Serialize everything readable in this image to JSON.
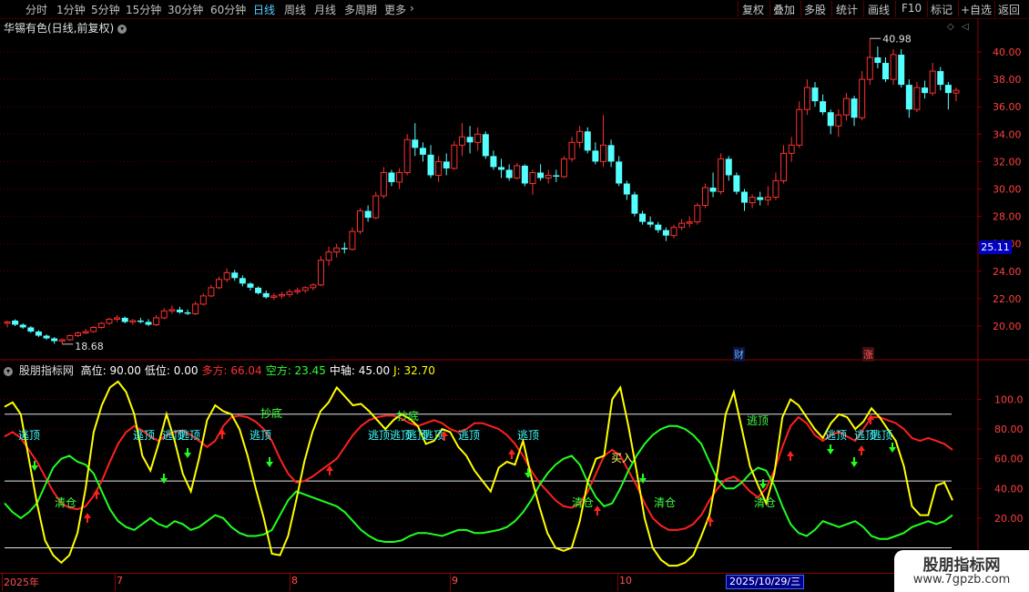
{
  "toolbar": {
    "periods": [
      {
        "label": "分时",
        "active": false
      },
      {
        "label": "1分钟",
        "active": false
      },
      {
        "label": "5分钟",
        "active": false
      },
      {
        "label": "15分钟",
        "active": false
      },
      {
        "label": "30分钟",
        "active": false
      },
      {
        "label": "60分钟",
        "active": false
      },
      {
        "label": "日线",
        "active": true
      },
      {
        "label": "周线",
        "active": false
      },
      {
        "label": "月线",
        "active": false
      },
      {
        "label": "多周期",
        "active": false
      },
      {
        "label": "更多",
        "active": false
      }
    ],
    "more_glyph": "›",
    "actions": [
      "复权",
      "叠加",
      "多股",
      "统计",
      "画线",
      "F10",
      "标记",
      "+自选",
      "返回"
    ]
  },
  "chart_title": "华锡有色(日线,前复权)",
  "price_axis_ticks": [
    "40.00",
    "38.00",
    "36.00",
    "34.00",
    "32.00",
    "30.00",
    "28.00",
    "26.00",
    "24.00",
    "22.00",
    "20.00"
  ],
  "price_high_label": "40.98",
  "price_low_label": "18.68",
  "current_price": "25.11",
  "fin_badge": "财",
  "zhang_badge": "涨",
  "indicator": {
    "name": "股朋指标网",
    "items": [
      {
        "label": "高位:",
        "value": "90.00",
        "color": "#ffffff"
      },
      {
        "label": "低位:",
        "value": "0.00",
        "color": "#ffffff"
      },
      {
        "label": "多方:",
        "value": "66.04",
        "color": "#ff3030"
      },
      {
        "label": "空方:",
        "value": "23.45",
        "color": "#30ff30"
      },
      {
        "label": "中轴:",
        "value": "45.00",
        "color": "#ffffff"
      },
      {
        "label": "J:",
        "value": "32.70",
        "color": "#ffff00"
      }
    ]
  },
  "indicator_axis_ticks": [
    "100.0",
    "80.00",
    "60.00",
    "40.00",
    "20.00"
  ],
  "signals": {
    "escape": "逃顶",
    "clear": "清仓",
    "bottom": "抄底",
    "buy": "买入"
  },
  "months": [
    "2025年",
    "7",
    "8",
    "9",
    "10"
  ],
  "date_cursor": "2025/10/29/三",
  "watermark": {
    "title": "股朋指标网",
    "url": "www.7gpzb.com"
  },
  "colors": {
    "up": "#ff3030",
    "down": "#54ffff",
    "bull": "#ff2020",
    "bear": "#20ff20",
    "j_line": "#ffff00"
  },
  "chart_data": [
    {
      "type": "candlestick",
      "title": "华锡有色(日线,前复权)",
      "ylim": [
        18.0,
        41.5
      ],
      "ohlc": [
        [
          20.2,
          20.4,
          19.9,
          20.3
        ],
        [
          20.4,
          20.5,
          20.0,
          20.1
        ],
        [
          20.1,
          20.2,
          19.8,
          19.9
        ],
        [
          19.9,
          20.0,
          19.5,
          19.6
        ],
        [
          19.6,
          19.7,
          19.2,
          19.3
        ],
        [
          19.3,
          19.4,
          19.0,
          19.1
        ],
        [
          19.1,
          19.2,
          18.7,
          18.9
        ],
        [
          18.9,
          19.1,
          18.68,
          19.0
        ],
        [
          19.0,
          19.4,
          18.9,
          19.3
        ],
        [
          19.3,
          19.6,
          19.2,
          19.5
        ],
        [
          19.5,
          19.8,
          19.4,
          19.6
        ],
        [
          19.6,
          20.0,
          19.5,
          19.9
        ],
        [
          19.9,
          20.3,
          19.8,
          20.2
        ],
        [
          20.2,
          20.6,
          20.1,
          20.5
        ],
        [
          20.5,
          20.8,
          20.3,
          20.6
        ],
        [
          20.6,
          20.7,
          20.2,
          20.3
        ],
        [
          20.3,
          20.5,
          20.1,
          20.4
        ],
        [
          20.4,
          20.6,
          20.2,
          20.3
        ],
        [
          20.3,
          20.5,
          20.0,
          20.1
        ],
        [
          20.1,
          20.8,
          20.0,
          20.6
        ],
        [
          20.6,
          21.3,
          20.5,
          21.1
        ],
        [
          21.1,
          21.5,
          20.9,
          21.2
        ],
        [
          21.2,
          21.4,
          20.9,
          21.0
        ],
        [
          21.0,
          21.2,
          20.8,
          20.9
        ],
        [
          20.9,
          21.8,
          20.8,
          21.6
        ],
        [
          21.6,
          22.4,
          21.5,
          22.2
        ],
        [
          22.2,
          23.0,
          22.1,
          22.8
        ],
        [
          22.8,
          23.6,
          22.7,
          23.4
        ],
        [
          23.4,
          24.2,
          23.2,
          23.9
        ],
        [
          23.9,
          24.1,
          23.3,
          23.5
        ],
        [
          23.5,
          23.7,
          22.9,
          23.1
        ],
        [
          23.1,
          23.2,
          22.6,
          22.8
        ],
        [
          22.8,
          22.9,
          22.3,
          22.4
        ],
        [
          22.4,
          22.6,
          22.0,
          22.1
        ],
        [
          22.1,
          22.4,
          21.9,
          22.2
        ],
        [
          22.2,
          22.5,
          22.0,
          22.3
        ],
        [
          22.3,
          22.7,
          22.1,
          22.5
        ],
        [
          22.5,
          22.8,
          22.3,
          22.6
        ],
        [
          22.6,
          22.9,
          22.4,
          22.8
        ],
        [
          22.8,
          23.1,
          22.6,
          23.0
        ],
        [
          23.0,
          25.1,
          22.9,
          24.8
        ],
        [
          24.8,
          25.8,
          24.4,
          25.4
        ],
        [
          25.4,
          26.0,
          25.0,
          25.7
        ],
        [
          25.7,
          26.1,
          25.3,
          25.6
        ],
        [
          25.6,
          27.2,
          25.5,
          26.9
        ],
        [
          26.9,
          28.6,
          26.7,
          28.4
        ],
        [
          28.4,
          28.8,
          27.6,
          27.9
        ],
        [
          27.9,
          29.8,
          27.8,
          29.5
        ],
        [
          29.5,
          31.6,
          29.3,
          31.2
        ],
        [
          31.2,
          31.4,
          30.2,
          30.5
        ],
        [
          30.5,
          31.5,
          30.0,
          31.2
        ],
        [
          31.2,
          34.0,
          31.0,
          33.6
        ],
        [
          33.6,
          34.8,
          32.4,
          33.0
        ],
        [
          33.0,
          33.4,
          32.0,
          32.5
        ],
        [
          32.5,
          33.2,
          30.8,
          31.0
        ],
        [
          31.0,
          32.4,
          30.5,
          32.0
        ],
        [
          32.0,
          32.6,
          31.0,
          31.5
        ],
        [
          31.5,
          33.5,
          31.4,
          33.2
        ],
        [
          33.2,
          34.8,
          32.4,
          33.8
        ],
        [
          33.8,
          34.6,
          32.6,
          33.4
        ],
        [
          33.4,
          34.5,
          32.8,
          34.0
        ],
        [
          34.0,
          34.2,
          32.2,
          32.4
        ],
        [
          32.4,
          32.8,
          31.4,
          31.6
        ],
        [
          31.6,
          32.2,
          30.8,
          31.4
        ],
        [
          31.4,
          31.8,
          30.6,
          30.8
        ],
        [
          30.8,
          31.9,
          30.7,
          31.7
        ],
        [
          31.7,
          31.8,
          30.2,
          30.4
        ],
        [
          30.4,
          31.4,
          29.6,
          31.2
        ],
        [
          31.2,
          31.8,
          30.6,
          30.8
        ],
        [
          30.8,
          31.4,
          30.4,
          31.0
        ],
        [
          31.0,
          31.4,
          30.5,
          30.9
        ],
        [
          30.9,
          32.4,
          30.8,
          32.2
        ],
        [
          32.2,
          33.8,
          32.0,
          33.4
        ],
        [
          33.4,
          34.6,
          33.0,
          34.2
        ],
        [
          34.2,
          34.5,
          32.6,
          32.8
        ],
        [
          32.8,
          33.4,
          31.8,
          32.0
        ],
        [
          32.0,
          35.4,
          31.6,
          33.2
        ],
        [
          33.2,
          33.6,
          31.6,
          32.0
        ],
        [
          32.0,
          32.4,
          30.2,
          30.4
        ],
        [
          30.4,
          30.6,
          29.2,
          29.6
        ],
        [
          29.6,
          29.8,
          28.0,
          28.2
        ],
        [
          28.2,
          28.4,
          27.4,
          27.6
        ],
        [
          27.6,
          28.0,
          27.2,
          27.4
        ],
        [
          27.4,
          27.6,
          26.8,
          27.0
        ],
        [
          27.0,
          27.2,
          26.2,
          26.6
        ],
        [
          26.6,
          27.4,
          26.4,
          27.2
        ],
        [
          27.2,
          27.8,
          27.0,
          27.5
        ],
        [
          27.5,
          28.0,
          27.2,
          27.6
        ],
        [
          27.6,
          29.0,
          27.4,
          28.8
        ],
        [
          28.8,
          30.4,
          28.6,
          30.1
        ],
        [
          30.1,
          31.2,
          29.4,
          29.8
        ],
        [
          29.8,
          32.6,
          29.6,
          32.2
        ],
        [
          32.2,
          32.4,
          30.6,
          31.0
        ],
        [
          31.0,
          31.2,
          29.6,
          29.8
        ],
        [
          29.8,
          30.0,
          28.4,
          29.0
        ],
        [
          29.0,
          29.6,
          28.6,
          29.4
        ],
        [
          29.4,
          29.8,
          28.8,
          29.2
        ],
        [
          29.2,
          30.2,
          28.8,
          29.4
        ],
        [
          29.4,
          31.2,
          29.2,
          30.6
        ],
        [
          30.6,
          33.2,
          30.4,
          32.6
        ],
        [
          32.6,
          33.8,
          32.0,
          33.2
        ],
        [
          33.2,
          36.4,
          33.0,
          35.8
        ],
        [
          35.8,
          38.0,
          35.4,
          37.4
        ],
        [
          37.4,
          37.8,
          36.0,
          36.4
        ],
        [
          36.4,
          36.9,
          35.4,
          35.6
        ],
        [
          35.6,
          35.8,
          34.0,
          34.6
        ],
        [
          34.6,
          35.8,
          33.8,
          35.4
        ],
        [
          35.4,
          37.0,
          35.0,
          36.6
        ],
        [
          36.6,
          36.8,
          34.6,
          35.2
        ],
        [
          35.2,
          38.6,
          35.0,
          38.0
        ],
        [
          38.0,
          40.98,
          37.6,
          39.6
        ],
        [
          39.6,
          40.4,
          38.8,
          39.2
        ],
        [
          39.2,
          39.6,
          37.8,
          38.0
        ],
        [
          38.0,
          40.2,
          37.6,
          39.8
        ],
        [
          39.8,
          40.2,
          37.4,
          37.6
        ],
        [
          37.6,
          38.0,
          35.2,
          35.8
        ],
        [
          35.8,
          37.8,
          35.6,
          37.4
        ],
        [
          37.4,
          37.9,
          36.6,
          37.0
        ],
        [
          37.0,
          39.2,
          36.8,
          38.6
        ],
        [
          38.6,
          38.9,
          37.2,
          37.6
        ],
        [
          37.6,
          37.8,
          35.8,
          37.0
        ],
        [
          37.0,
          37.4,
          36.4,
          37.2
        ]
      ]
    },
    {
      "type": "line",
      "title": "股朋指标网",
      "ylim": [
        -10,
        110
      ],
      "reference_lines": [
        {
          "name": "高位",
          "value": 90.0
        },
        {
          "name": "低位",
          "value": 0.0
        },
        {
          "name": "中轴",
          "value": 45.0
        }
      ],
      "series": [
        {
          "name": "多方",
          "values": [
            75,
            78,
            74,
            66,
            58,
            48,
            38,
            30,
            27,
            26,
            28,
            35,
            45,
            58,
            70,
            78,
            82,
            79,
            75,
            72,
            76,
            78,
            79,
            76,
            72,
            68,
            72,
            82,
            88,
            89,
            88,
            85,
            80,
            72,
            60,
            50,
            44,
            45,
            48,
            52,
            56,
            60,
            68,
            76,
            82,
            86,
            88,
            89,
            89,
            87,
            84,
            82,
            84,
            86,
            84,
            80,
            78,
            80,
            84,
            84,
            82,
            80,
            76,
            70,
            62,
            52,
            44,
            38,
            32,
            28,
            27,
            30,
            38,
            50,
            62,
            66,
            62,
            52,
            42,
            30,
            20,
            15,
            12,
            12,
            13,
            16,
            22,
            32,
            40,
            46,
            48,
            44,
            38,
            34,
            40,
            52,
            68,
            82,
            88,
            84,
            76,
            72,
            76,
            78,
            75,
            72,
            80,
            88,
            88,
            86,
            84,
            80,
            74,
            72,
            74,
            72,
            70,
            66
          ]
        },
        {
          "name": "空方",
          "values": [
            30,
            24,
            20,
            24,
            30,
            42,
            54,
            60,
            62,
            58,
            56,
            50,
            38,
            26,
            18,
            14,
            12,
            16,
            20,
            16,
            14,
            18,
            16,
            12,
            14,
            18,
            22,
            20,
            14,
            10,
            8,
            8,
            9,
            12,
            22,
            32,
            38,
            36,
            34,
            32,
            30,
            28,
            24,
            18,
            12,
            8,
            5,
            4,
            4,
            5,
            8,
            10,
            10,
            9,
            8,
            10,
            12,
            12,
            10,
            10,
            11,
            12,
            14,
            18,
            24,
            32,
            42,
            50,
            56,
            60,
            62,
            56,
            44,
            34,
            28,
            30,
            40,
            52,
            62,
            70,
            76,
            80,
            82,
            82,
            80,
            76,
            70,
            58,
            46,
            40,
            40,
            44,
            50,
            54,
            52,
            42,
            28,
            16,
            10,
            8,
            12,
            18,
            16,
            14,
            16,
            18,
            14,
            8,
            6,
            6,
            8,
            10,
            14,
            16,
            18,
            16,
            18,
            22
          ]
        },
        {
          "name": "J",
          "values": [
            95,
            98,
            90,
            60,
            30,
            5,
            -5,
            -10,
            -5,
            10,
            40,
            78,
            96,
            108,
            112,
            105,
            90,
            62,
            52,
            70,
            90,
            72,
            50,
            38,
            60,
            86,
            96,
            92,
            90,
            80,
            62,
            40,
            20,
            -4,
            -5,
            8,
            32,
            58,
            78,
            92,
            98,
            108,
            102,
            96,
            97,
            92,
            86,
            80,
            86,
            90,
            87,
            82,
            70,
            72,
            80,
            78,
            68,
            62,
            52,
            45,
            38,
            54,
            58,
            56,
            72,
            48,
            28,
            10,
            0,
            -2,
            0,
            18,
            45,
            60,
            62,
            100,
            108,
            82,
            52,
            20,
            0,
            -8,
            -12,
            -12,
            -10,
            -5,
            8,
            22,
            52,
            90,
            105,
            80,
            55,
            42,
            30,
            50,
            88,
            100,
            96,
            88,
            80,
            74,
            84,
            90,
            88,
            80,
            85,
            94,
            88,
            80,
            72,
            55,
            28,
            22,
            22,
            42,
            44,
            32
          ]
        }
      ]
    }
  ]
}
